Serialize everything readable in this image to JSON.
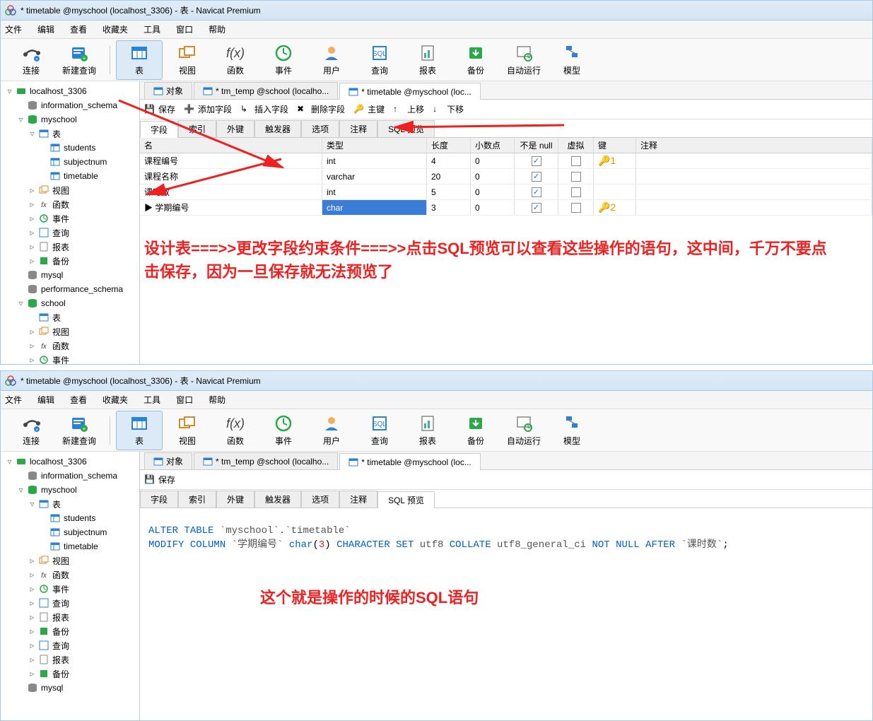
{
  "window_title": "* timetable @myschool (localhost_3306) - 表 - Navicat Premium",
  "menu": [
    "文件",
    "编辑",
    "查看",
    "收藏夹",
    "工具",
    "窗口",
    "帮助"
  ],
  "toolbar": [
    {
      "label": "连接"
    },
    {
      "label": "新建查询"
    },
    {
      "label": "表",
      "active": true
    },
    {
      "label": "视图"
    },
    {
      "label": "函数"
    },
    {
      "label": "事件"
    },
    {
      "label": "用户"
    },
    {
      "label": "查询"
    },
    {
      "label": "报表"
    },
    {
      "label": "备份"
    },
    {
      "label": "自动运行"
    },
    {
      "label": "模型"
    }
  ],
  "tree": [
    {
      "d": 0,
      "t": "▿",
      "i": "server",
      "label": "localhost_3306"
    },
    {
      "d": 1,
      "t": "",
      "i": "db",
      "label": "information_schema"
    },
    {
      "d": 1,
      "t": "▿",
      "i": "db-open",
      "label": "myschool"
    },
    {
      "d": 2,
      "t": "▿",
      "i": "table-folder",
      "label": "表"
    },
    {
      "d": 3,
      "t": "",
      "i": "table",
      "label": "students"
    },
    {
      "d": 3,
      "t": "",
      "i": "table",
      "label": "subjectnum"
    },
    {
      "d": 3,
      "t": "",
      "i": "table",
      "label": "timetable"
    },
    {
      "d": 2,
      "t": "▹",
      "i": "view",
      "label": "视图"
    },
    {
      "d": 2,
      "t": "▹",
      "i": "fx",
      "label": "函数"
    },
    {
      "d": 2,
      "t": "▹",
      "i": "event",
      "label": "事件"
    },
    {
      "d": 2,
      "t": "▹",
      "i": "query",
      "label": "查询"
    },
    {
      "d": 2,
      "t": "▹",
      "i": "report",
      "label": "报表"
    },
    {
      "d": 2,
      "t": "▹",
      "i": "backup",
      "label": "备份"
    },
    {
      "d": 1,
      "t": "",
      "i": "db",
      "label": "mysql"
    },
    {
      "d": 1,
      "t": "",
      "i": "db",
      "label": "performance_schema"
    },
    {
      "d": 1,
      "t": "▿",
      "i": "db-open",
      "label": "school"
    },
    {
      "d": 2,
      "t": "",
      "i": "table-folder",
      "label": "表"
    },
    {
      "d": 2,
      "t": "▹",
      "i": "view",
      "label": "视图"
    },
    {
      "d": 2,
      "t": "▹",
      "i": "fx",
      "label": "函数"
    },
    {
      "d": 2,
      "t": "▹",
      "i": "event",
      "label": "事件"
    }
  ],
  "tree2_tail": [
    {
      "d": 2,
      "t": "▹",
      "i": "query",
      "label": "查询"
    },
    {
      "d": 2,
      "t": "▹",
      "i": "report",
      "label": "报表"
    },
    {
      "d": 2,
      "t": "▹",
      "i": "backup",
      "label": "备份"
    },
    {
      "d": 1,
      "t": "",
      "i": "db",
      "label": "mysql"
    }
  ],
  "tabs": [
    {
      "label": "对象"
    },
    {
      "label": "* tm_temp @school (localho..."
    },
    {
      "label": "* timetable @myschool (loc...",
      "active": true
    }
  ],
  "actbar": [
    {
      "label": "保存"
    },
    {
      "label": "添加字段"
    },
    {
      "label": "插入字段"
    },
    {
      "label": "删除字段"
    },
    {
      "label": "主键"
    },
    {
      "label": "上移"
    },
    {
      "label": "下移"
    }
  ],
  "actbar2": [
    {
      "label": "保存"
    }
  ],
  "design_tabs": [
    "字段",
    "索引",
    "外键",
    "触发器",
    "选项",
    "注释",
    "SQL 预览"
  ],
  "design_active_top": 0,
  "design_active_bot": 6,
  "grid_cols": [
    "名",
    "类型",
    "长度",
    "小数点",
    "不是 null",
    "虚拟",
    "键",
    "注释"
  ],
  "grid_rows": [
    {
      "name": "课程编号",
      "type": "int",
      "len": "4",
      "dec": "0",
      "nn": true,
      "virt": false,
      "key": "🔑1"
    },
    {
      "name": "课程名称",
      "type": "varchar",
      "len": "20",
      "dec": "0",
      "nn": true,
      "virt": false,
      "key": ""
    },
    {
      "name": "课时数",
      "type": "int",
      "len": "5",
      "dec": "0",
      "nn": true,
      "virt": false,
      "key": ""
    },
    {
      "name": "学期编号",
      "type": "char",
      "len": "3",
      "dec": "0",
      "nn": true,
      "virt": false,
      "key": "🔑2",
      "sel": true,
      "mark": "▶"
    }
  ],
  "anno1": "设计表===>>更改字段约束条件===>>点击SQL预览可以查看这些操作的语句，这中间，千万不要点击保存，因为一旦保存就无法预览了",
  "anno2": "这个就是操作的时候的SQL语句",
  "sql": {
    "l1": {
      "alter": "ALTER",
      "table": "TABLE",
      "tbl": "`myschool`.`timetable`"
    },
    "l2": {
      "modify": "MODIFY",
      "column": "COLUMN",
      "col": "`学期编号`",
      "type": "char",
      "n": "3",
      "cs": "CHARACTER",
      "set": "SET",
      "utf8": "utf8",
      "col2": "COLLATE",
      "ci": "utf8_general_ci",
      "nn": "NOT",
      "null": "NULL",
      "after": "AFTER",
      "after_col": "`课时数`"
    }
  }
}
